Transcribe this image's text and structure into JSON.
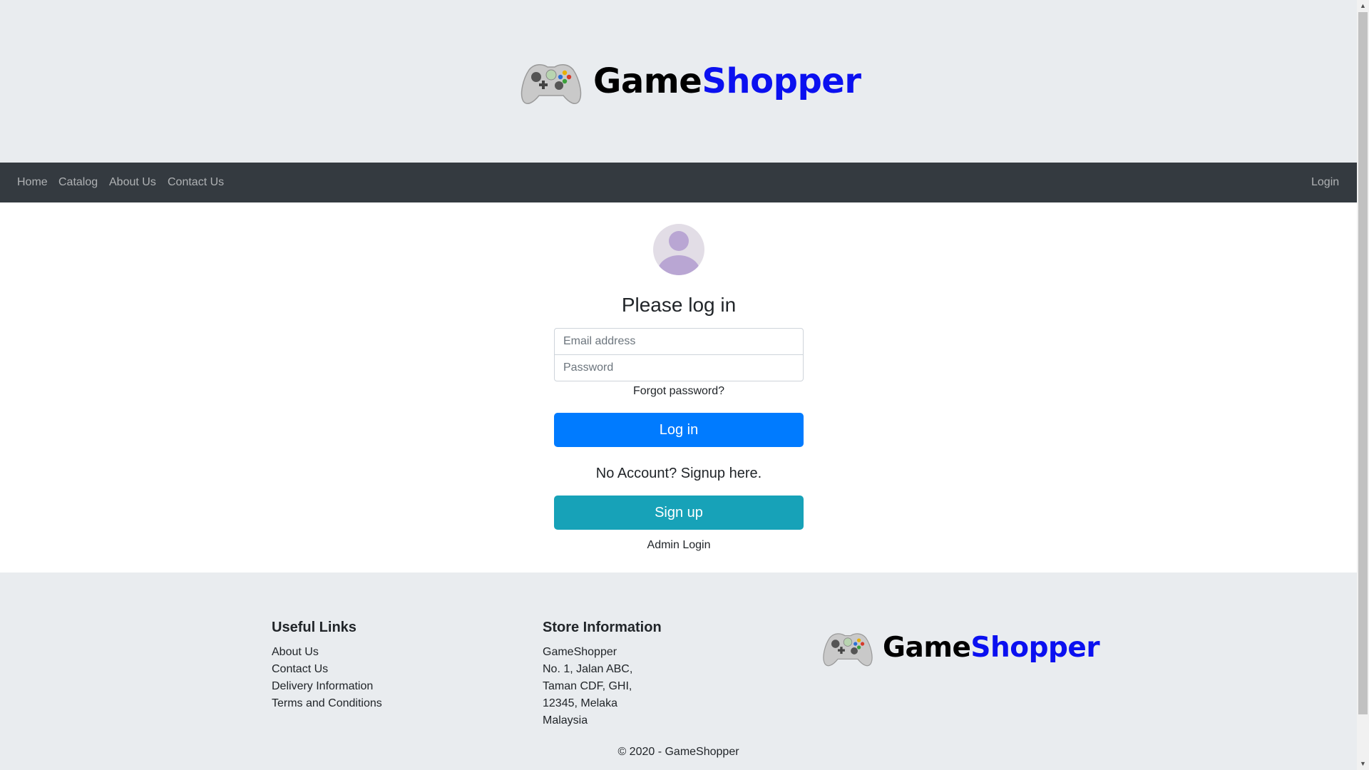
{
  "brand": {
    "name_part1": "Game",
    "name_part2": "Shopper",
    "logo_icon": "gamepad-icon",
    "color_primary": "#000000",
    "color_accent": "#0b10f0"
  },
  "nav": {
    "left_items": [
      "Home",
      "Catalog",
      "About Us",
      "Contact Us"
    ],
    "right_item": "Login"
  },
  "login": {
    "avatar_icon": "user-avatar-icon",
    "title": "Please log in",
    "email_placeholder": "Email address",
    "email_value": "",
    "password_placeholder": "Password",
    "password_value": "",
    "forgot_password": "Forgot password?",
    "login_button": "Log in",
    "no_account_text": "No Account? Signup here.",
    "signup_button": "Sign up",
    "admin_login": "Admin Login",
    "colors": {
      "login_button": "#007bff",
      "signup_button": "#17a2b8"
    }
  },
  "footer": {
    "useful_links": {
      "heading": "Useful Links",
      "items": [
        "About Us",
        "Contact Us",
        "Delivery Information",
        "Terms and Conditions"
      ]
    },
    "store_info": {
      "heading": "Store Information",
      "lines": [
        "GameShopper",
        "No. 1, Jalan ABC,",
        "Taman CDF, GHI,",
        "12345, Melaka",
        "Malaysia"
      ]
    },
    "copyright": "© 2020 - GameShopper"
  }
}
